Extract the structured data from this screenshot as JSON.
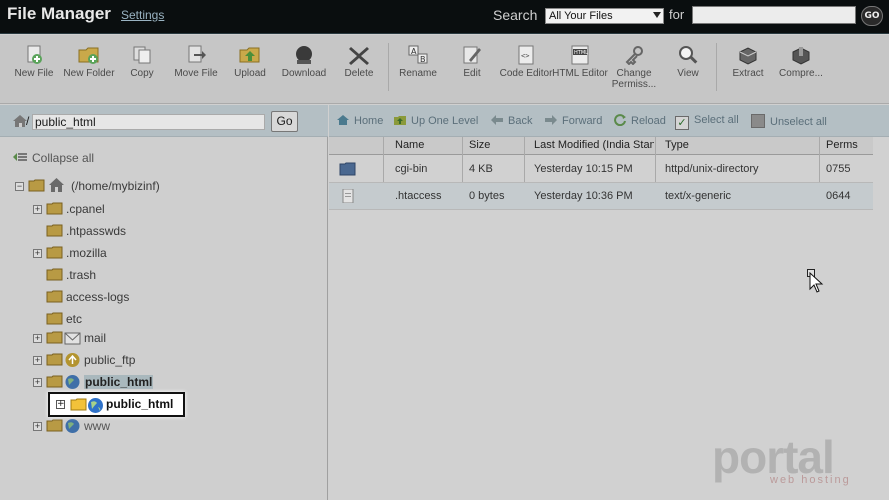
{
  "header": {
    "title": "File Manager",
    "settings_link": "Settings",
    "search_label": "Search",
    "search_scope": "All Your Files",
    "for_label": "for",
    "search_value": "",
    "go_label": "GO"
  },
  "toolbar": {
    "items": [
      {
        "label": "New File",
        "icon": "new-file-icon"
      },
      {
        "label": "New Folder",
        "icon": "new-folder-icon"
      },
      {
        "label": "Copy",
        "icon": "copy-icon"
      },
      {
        "label": "Move File",
        "icon": "move-file-icon"
      },
      {
        "label": "Upload",
        "icon": "upload-icon"
      },
      {
        "label": "Download",
        "icon": "download-icon"
      },
      {
        "label": "Delete",
        "icon": "delete-icon"
      },
      {
        "label": "Rename",
        "icon": "rename-icon"
      },
      {
        "label": "Edit",
        "icon": "edit-icon"
      },
      {
        "label": "Code Editor",
        "icon": "code-editor-icon"
      },
      {
        "label": "HTML Editor",
        "icon": "html-editor-icon"
      },
      {
        "label": "Change Permiss...",
        "icon": "permissions-icon"
      },
      {
        "label": "View",
        "icon": "view-icon"
      },
      {
        "label": "Extract",
        "icon": "extract-icon"
      },
      {
        "label": "Compre...",
        "icon": "compress-icon"
      }
    ]
  },
  "pathbar": {
    "prefix": "/",
    "value": "public_html",
    "go_label": "Go"
  },
  "tree": {
    "collapse_all": "Collapse all",
    "root": "(/home/mybizinf)",
    "items": [
      {
        "label": ".cpanel"
      },
      {
        "label": ".htpasswds"
      },
      {
        "label": ".mozilla"
      },
      {
        "label": ".trash"
      },
      {
        "label": "access-logs"
      },
      {
        "label": "etc"
      },
      {
        "label": "mail"
      },
      {
        "label": "public_ftp"
      },
      {
        "label": "public_html"
      },
      {
        "label": "public_html"
      },
      {
        "label": "www"
      }
    ]
  },
  "nav": {
    "home": "Home",
    "up_one_level": "Up One Level",
    "back": "Back",
    "forward": "Forward",
    "reload": "Reload",
    "select_all": "Select all",
    "unselect_all": "Unselect all"
  },
  "files": {
    "columns": [
      "Name",
      "Size",
      "Last Modified (India Standard Time)",
      "Type",
      "Perms"
    ],
    "rows": [
      {
        "name": "cgi-bin",
        "size": "4 KB",
        "modified": "Yesterday 10:15 PM",
        "type": "httpd/unix-directory",
        "perms": "0755",
        "icon": "folder-icon"
      },
      {
        "name": ".htaccess",
        "size": "0 bytes",
        "modified": "Yesterday 10:36 PM",
        "type": "text/x-generic",
        "perms": "0644",
        "icon": "file-icon"
      }
    ]
  },
  "watermark": {
    "brand": "portal",
    "tagline": "web hosting"
  },
  "colors": {
    "topbar": "#0a0e0f",
    "path_bar": "#b4bfc4",
    "highlight": "#ffffff"
  }
}
